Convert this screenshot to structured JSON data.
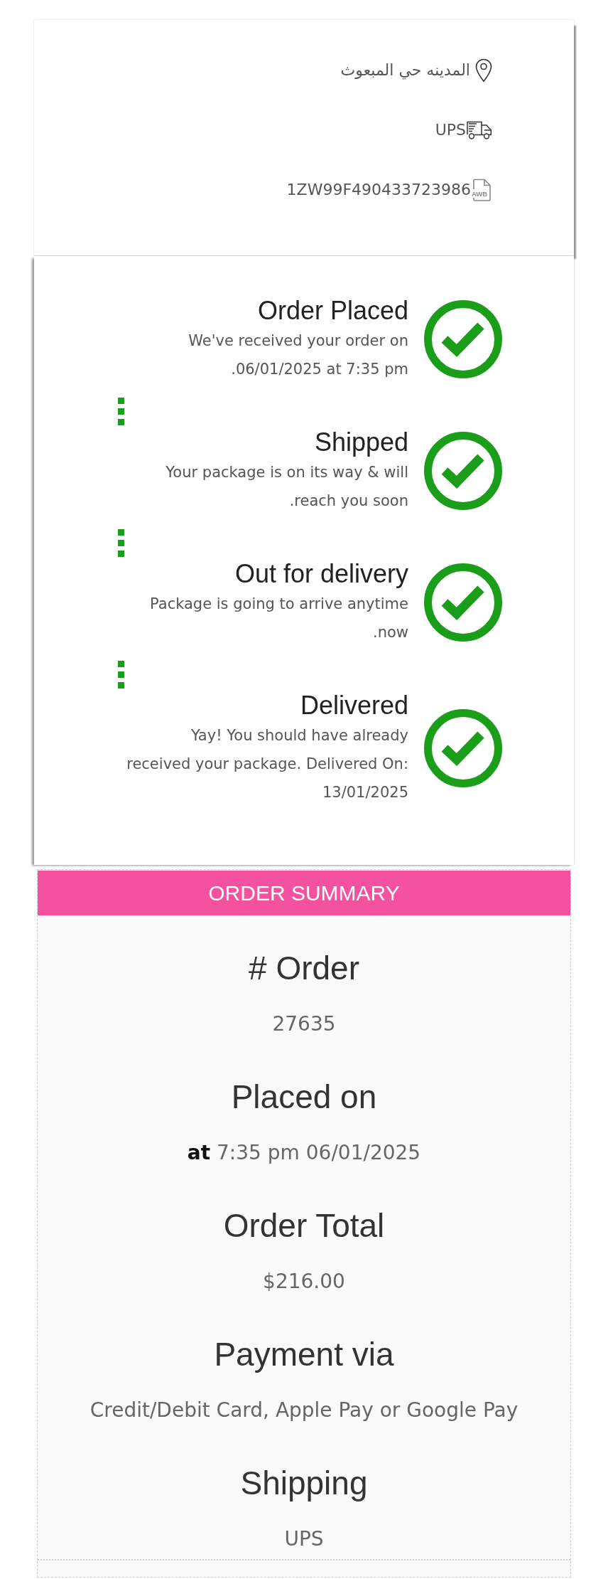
{
  "shipment": {
    "details": [
      {
        "kind": "address",
        "text": "المدينه حي المبعوث"
      },
      {
        "kind": "carrier",
        "text": "UPS"
      },
      {
        "kind": "waybill",
        "text": "1ZW99F490433723986",
        "icon_text": "AWB"
      }
    ]
  },
  "tracking_steps": [
    {
      "title": "Order Placed",
      "description": "We've received your order on\n.06/01/2025 at 7:35 pm",
      "completed": true
    },
    {
      "title": "Shipped",
      "description": "Your package is on its way & will\n.reach you soon",
      "completed": true
    },
    {
      "title": "Out for delivery",
      "description": "Package is going to arrive anytime\n.now",
      "completed": true
    },
    {
      "title": "Delivered",
      "description": "Yay! You should have already\nreceived your package. Delivered On:\n13/01/2025",
      "completed": true
    }
  ],
  "order_summary": {
    "title": "ORDER SUMMARY",
    "fields": [
      {
        "label": "# Order",
        "value": "27635"
      },
      {
        "label": "Placed on",
        "value": "**at** 7:35 pm 06/01/2025"
      },
      {
        "label": "Order Total",
        "value": "$216.00"
      },
      {
        "label": "Payment via",
        "value": "Credit/Debit Card, Apple Pay or Google Pay"
      },
      {
        "label": "Shipping",
        "value": "UPS"
      }
    ]
  }
}
